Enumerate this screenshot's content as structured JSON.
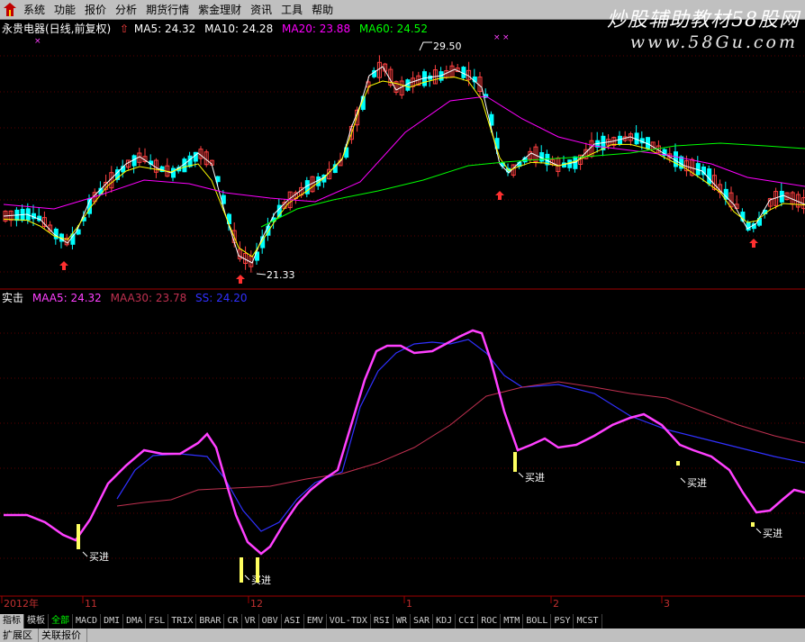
{
  "menu": [
    "系统",
    "功能",
    "报价",
    "分析",
    "期货行情",
    "紫金理财",
    "资讯",
    "工具",
    "帮助"
  ],
  "brand": "炒股辅助教材58股网",
  "brand_url": "www.58Gu.com",
  "price_header": {
    "stock": "永贵电器(日线,前复权)",
    "ma5": "MA5: 24.32",
    "ma10": "MA10: 24.28",
    "ma20": "MA20: 23.88",
    "ma60": "MA60: 24.52"
  },
  "indicator_header": {
    "name": "实击",
    "maa5": "MAA5: 24.32",
    "maa30": "MAA30: 23.78",
    "ss": "SS: 24.20"
  },
  "annotations": {
    "high": "29.50",
    "low": "21.33",
    "buy": "买进"
  },
  "date_axis": [
    "2012年",
    "11",
    "12",
    "1",
    "2",
    "3"
  ],
  "tabs": [
    "指标",
    "模板",
    "全部",
    "MACD",
    "DMI",
    "DMA",
    "FSL",
    "TRIX",
    "BRAR",
    "CR",
    "VR",
    "OBV",
    "ASI",
    "EMV",
    "VOL-TDX",
    "RSI",
    "WR",
    "SAR",
    "KDJ",
    "CCI",
    "ROC",
    "MTM",
    "BOLL",
    "PSY",
    "MCST"
  ],
  "status": [
    "扩展区",
    "关联报价"
  ],
  "colors": {
    "up": "#ff4040",
    "down": "#00ffff",
    "ma5": "#ffffff",
    "ma10": "#ffff00",
    "ma20": "#ff00ff",
    "ma60": "#00ff00",
    "maa5": "#ff40ff",
    "maa30": "#c03050",
    "ss": "#3030ff",
    "buy_bar": "#ffff60"
  }
}
